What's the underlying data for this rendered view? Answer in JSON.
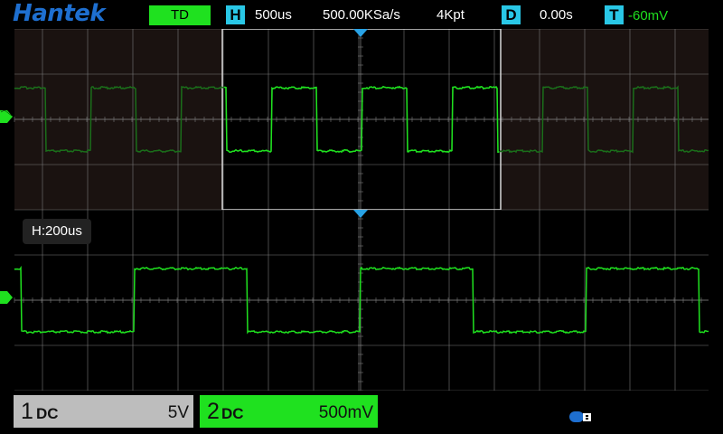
{
  "header": {
    "brand": "Hantek",
    "mode": "TD",
    "timebase_letter": "H",
    "timebase": "500us",
    "sample_rate": "500.00KSa/s",
    "memory_depth": "4Kpt",
    "delay_letter": "D",
    "delay": "0.00s",
    "trigger_letter": "T",
    "trigger_level": "-60mV"
  },
  "zoom": {
    "label": "H:200us"
  },
  "channels": [
    {
      "number": "1",
      "coupling": "DC",
      "scale": "5V"
    },
    {
      "number": "2",
      "coupling": "DC",
      "scale": "500mV"
    }
  ],
  "colors": {
    "trace": "#1fe11f",
    "accent": "#29c7e6",
    "brand": "#1e6fd0",
    "grid": "#7a7a7a",
    "channel1_bg": "#bdbdbd",
    "channel2_bg": "#1fe11f"
  },
  "icons": {
    "trigger_position": "triangle-marker-icon",
    "channel_level": "channel-ground-marker-icon",
    "usb": "usb-icon"
  }
}
